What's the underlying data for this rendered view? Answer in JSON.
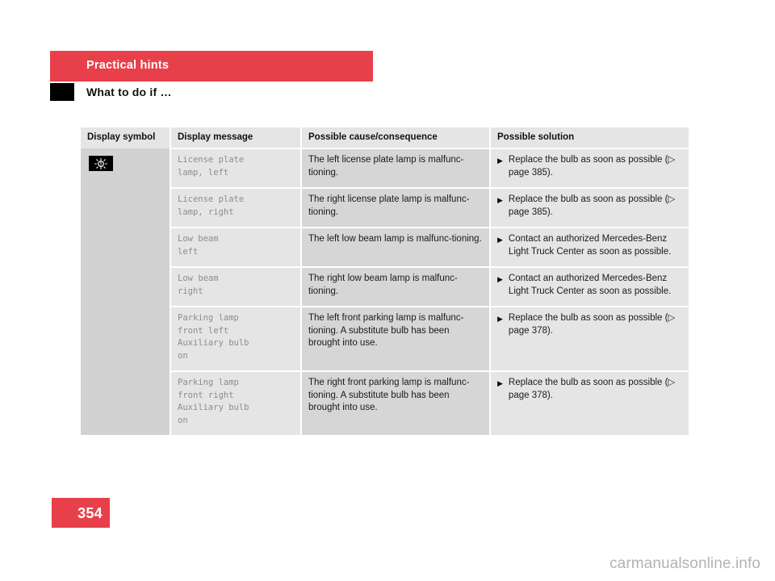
{
  "header": {
    "chapter": "Practical hints",
    "section": "What to do if …",
    "chapter_bar_color": "#e8404a",
    "section_tab_color": "#000000"
  },
  "table": {
    "columns": [
      "Display symbol",
      "Display message",
      "Possible cause/consequence",
      "Possible solution"
    ],
    "symbol": {
      "icon": "lamp-malfunction-icon",
      "background": "#000000",
      "foreground": "#ffffff"
    },
    "rows": [
      {
        "message": "License plate\nlamp, left",
        "cause": "The left license plate lamp is malfunc‐tioning.",
        "solution_bullet": "▶",
        "solution": "Replace the bulb as soon as possible (▷ page 385)."
      },
      {
        "message": "License plate\nlamp, right",
        "cause": "The right license plate lamp is malfunc‐tioning.",
        "solution_bullet": "▶",
        "solution": "Replace the bulb as soon as possible (▷ page 385)."
      },
      {
        "message": "Low beam\nleft",
        "cause": "The left low beam lamp is malfunc‐tioning.",
        "solution_bullet": "▶",
        "solution": "Contact an authorized Mercedes-Benz Light Truck Center as soon as possible."
      },
      {
        "message": "Low beam\nright",
        "cause": "The right low beam lamp is malfunc‐tioning.",
        "solution_bullet": "▶",
        "solution": "Contact an authorized Mercedes-Benz Light Truck Center as soon as possible."
      },
      {
        "message": "Parking lamp\nfront left\nAuxiliary bulb\non",
        "cause": "The left front parking lamp is malfunc‐tioning. A substitute bulb has been brought into use.",
        "solution_bullet": "▶",
        "solution": "Replace the bulb as soon as possible (▷ page 378)."
      },
      {
        "message": "Parking lamp\nfront right\nAuxiliary bulb\non",
        "cause": "The right front parking lamp is malfunc‐tioning. A substitute bulb has been brought into use.",
        "solution_bullet": "▶",
        "solution": "Replace the bulb as soon as possible (▷ page 378)."
      }
    ]
  },
  "footer": {
    "page_number": "354",
    "page_badge_color": "#e8404a",
    "watermark": "carmanualsonline.info"
  }
}
